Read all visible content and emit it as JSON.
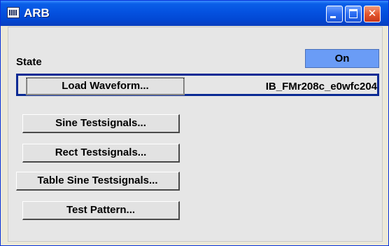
{
  "window": {
    "title": "ARB"
  },
  "state": {
    "label": "State",
    "value": "On"
  },
  "load_waveform": {
    "button_label": "Load Waveform...",
    "value": "IB_FMr208c_e0wfc204"
  },
  "buttons": {
    "sine": "Sine Testsignals...",
    "rect": "Rect Testsignals...",
    "table_sine": "Table Sine Testsignals...",
    "test_pattern": "Test Pattern..."
  },
  "icons": {
    "app": "arb-app-icon",
    "minimize": "minimize-icon",
    "maximize": "maximize-icon",
    "close": "close-icon"
  },
  "colors": {
    "titlebar": "#0553e1",
    "on_button": "#6a9cf6",
    "focus_border": "#0a2a94",
    "close_button": "#e4572e"
  }
}
